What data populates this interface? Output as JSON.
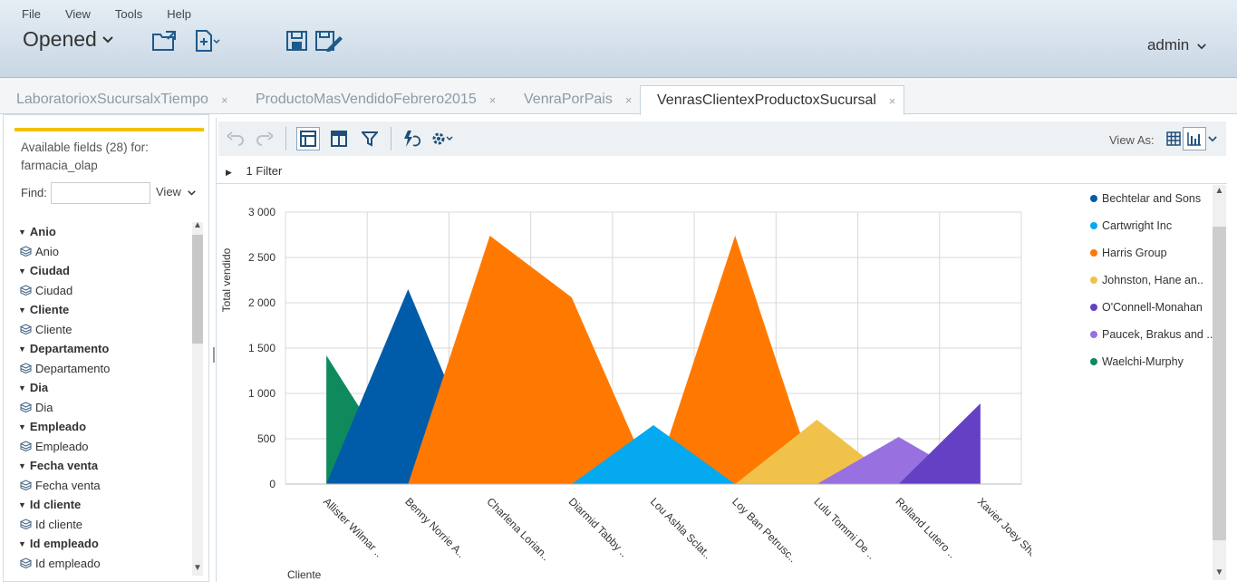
{
  "menu": [
    "File",
    "View",
    "Tools",
    "Help"
  ],
  "header": {
    "opened_label": "Opened",
    "user": "admin"
  },
  "tabs": [
    {
      "label": "LaboratorioxSucursalxTiempo",
      "close": "×"
    },
    {
      "label": "ProductoMasVendidoFebrero2015",
      "close": "×"
    },
    {
      "label": "VenraPorPais",
      "close": "×"
    },
    {
      "label": "VenrasClientexProductoxSucursal",
      "close": "×",
      "active": true
    }
  ],
  "left_panel": {
    "available_line1": "Available fields (28) for:",
    "available_line2": "farmacia_olap",
    "find_label": "Find:",
    "find_value": "",
    "view_label": "View",
    "fields": [
      {
        "group": "Anio",
        "leaf": "Anio"
      },
      {
        "group": "Ciudad",
        "leaf": "Ciudad"
      },
      {
        "group": "Cliente",
        "leaf": "Cliente"
      },
      {
        "group": "Departamento",
        "leaf": "Departamento"
      },
      {
        "group": "Dia",
        "leaf": "Dia"
      },
      {
        "group": "Empleado",
        "leaf": "Empleado"
      },
      {
        "group": "Fecha venta",
        "leaf": "Fecha venta"
      },
      {
        "group": "Id cliente",
        "leaf": "Id cliente"
      },
      {
        "group": "Id empleado",
        "leaf": "Id empleado"
      }
    ]
  },
  "toolbar": {
    "view_as_label": "View As:",
    "filter_label": "1 Filter"
  },
  "chart_data": {
    "type": "area",
    "ylabel": "Total vendido",
    "xlabel": "Cliente",
    "ylim": [
      0,
      3000
    ],
    "yticks": [
      "0",
      "500",
      "1 000",
      "1 500",
      "2 000",
      "2 500",
      "3 000"
    ],
    "ytick_values": [
      0,
      500,
      1000,
      1500,
      2000,
      2500,
      3000
    ],
    "categories": [
      "Allister Wilmar ..",
      "Benny Norrie A..",
      "Charlena Lorian..",
      "Diarmid Tabby ..",
      "Lou Ashla Sclat..",
      "Loy Ban Petrusc..",
      "Lulu Tommi De ..",
      "Rolland Lutero ..",
      "Xavier Joey She.."
    ],
    "series": [
      {
        "name": "Waelchi-Murphy",
        "color": "#0e8a5c",
        "values": [
          1420,
          0,
          0,
          0,
          0,
          0,
          0,
          0,
          0
        ]
      },
      {
        "name": "Bechtelar and Sons",
        "color": "#005ca8",
        "values": [
          0,
          2150,
          0,
          0,
          0,
          0,
          0,
          0,
          0
        ]
      },
      {
        "name": "Harris Group",
        "color": "#ff7900",
        "values": [
          0,
          0,
          2740,
          2060,
          0,
          2740,
          0,
          0,
          0
        ]
      },
      {
        "name": "Cartwright Inc",
        "color": "#05a9f0",
        "values": [
          0,
          0,
          0,
          0,
          650,
          0,
          0,
          0,
          0
        ]
      },
      {
        "name": "Johnston, Hane an..",
        "color": "#f0c24a",
        "values": [
          0,
          0,
          0,
          0,
          0,
          0,
          710,
          0,
          0
        ]
      },
      {
        "name": "Paucek, Brakus and ..",
        "color": "#9870e0",
        "values": [
          0,
          0,
          0,
          0,
          0,
          0,
          0,
          520,
          0
        ]
      },
      {
        "name": "O'Connell-Monahan",
        "color": "#6441c4",
        "values": [
          0,
          0,
          0,
          0,
          0,
          0,
          0,
          0,
          890
        ]
      }
    ],
    "legend_order": [
      "Bechtelar and Sons",
      "Cartwright Inc",
      "Harris Group",
      "Johnston, Hane an..",
      "O'Connell-Monahan",
      "Paucek, Brakus and ..",
      "Waelchi-Murphy"
    ],
    "legend": "right",
    "grid": true
  }
}
